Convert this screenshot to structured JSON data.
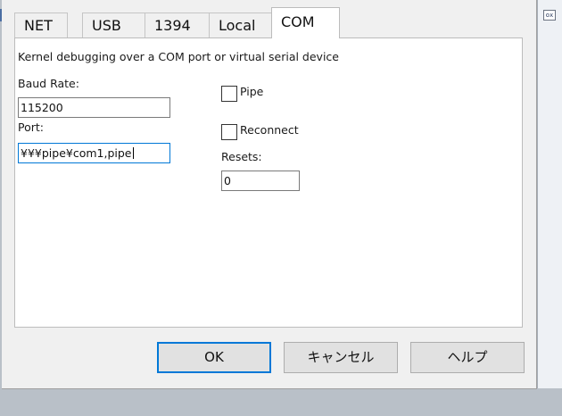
{
  "tabs": [
    {
      "label": "NET",
      "active": false
    },
    {
      "label": "USB",
      "active": false
    },
    {
      "label": "1394",
      "active": false
    },
    {
      "label": "Local",
      "active": false
    },
    {
      "label": "COM",
      "active": true
    }
  ],
  "com": {
    "description": "Kernel debugging over a COM port or virtual serial device",
    "baud_rate_label": "Baud Rate:",
    "baud_rate_value": "115200",
    "port_label": "Port:",
    "port_value": "¥¥¥pipe¥com1,pipe",
    "pipe_label": "Pipe",
    "pipe_checked": false,
    "reconnect_label": "Reconnect",
    "reconnect_checked": false,
    "resets_label": "Resets:",
    "resets_value": "0"
  },
  "buttons": {
    "ok": "OK",
    "cancel": "キャンセル",
    "help": "ヘルプ"
  },
  "background": {
    "right_icon_text": "ox"
  },
  "colors": {
    "accent": "#0078d7",
    "dialog_face": "#f0f0f0",
    "panel": "#ffffff",
    "backdrop": "#b9c0c8"
  }
}
